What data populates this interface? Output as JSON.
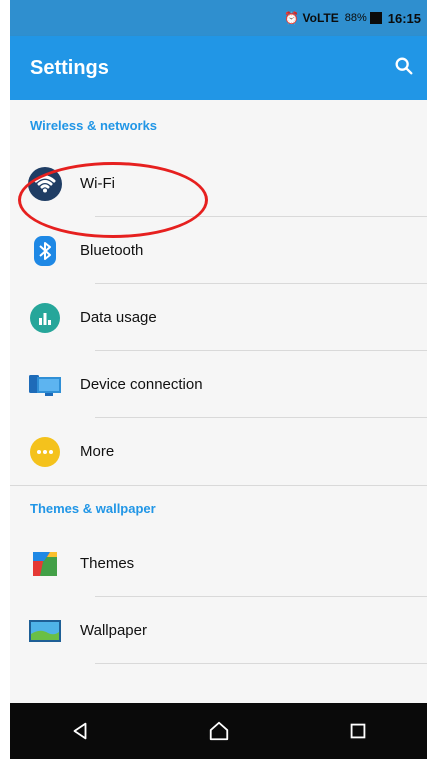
{
  "statusbar": {
    "left_icons": "⏰ VoLTE",
    "battery": "88%",
    "time": "16:15"
  },
  "appbar": {
    "title": "Settings",
    "search_icon": "search-icon"
  },
  "sections": [
    {
      "header": "Wireless & networks",
      "items": [
        {
          "label": "Wi-Fi",
          "icon": "wifi-icon"
        },
        {
          "label": "Bluetooth",
          "icon": "bluetooth-icon"
        },
        {
          "label": "Data usage",
          "icon": "data-usage-icon"
        },
        {
          "label": "Device connection",
          "icon": "device-connection-icon"
        },
        {
          "label": "More",
          "icon": "more-icon"
        }
      ]
    },
    {
      "header": "Themes & wallpaper",
      "items": [
        {
          "label": "Themes",
          "icon": "themes-icon"
        },
        {
          "label": "Wallpaper",
          "icon": "wallpaper-icon"
        }
      ]
    }
  ],
  "navbar": {
    "back": "back-icon",
    "home": "home-icon",
    "recents": "recents-icon"
  },
  "colors": {
    "primary": "#2196e6",
    "status": "#2f8fcf",
    "highlight": "#e6201f"
  }
}
